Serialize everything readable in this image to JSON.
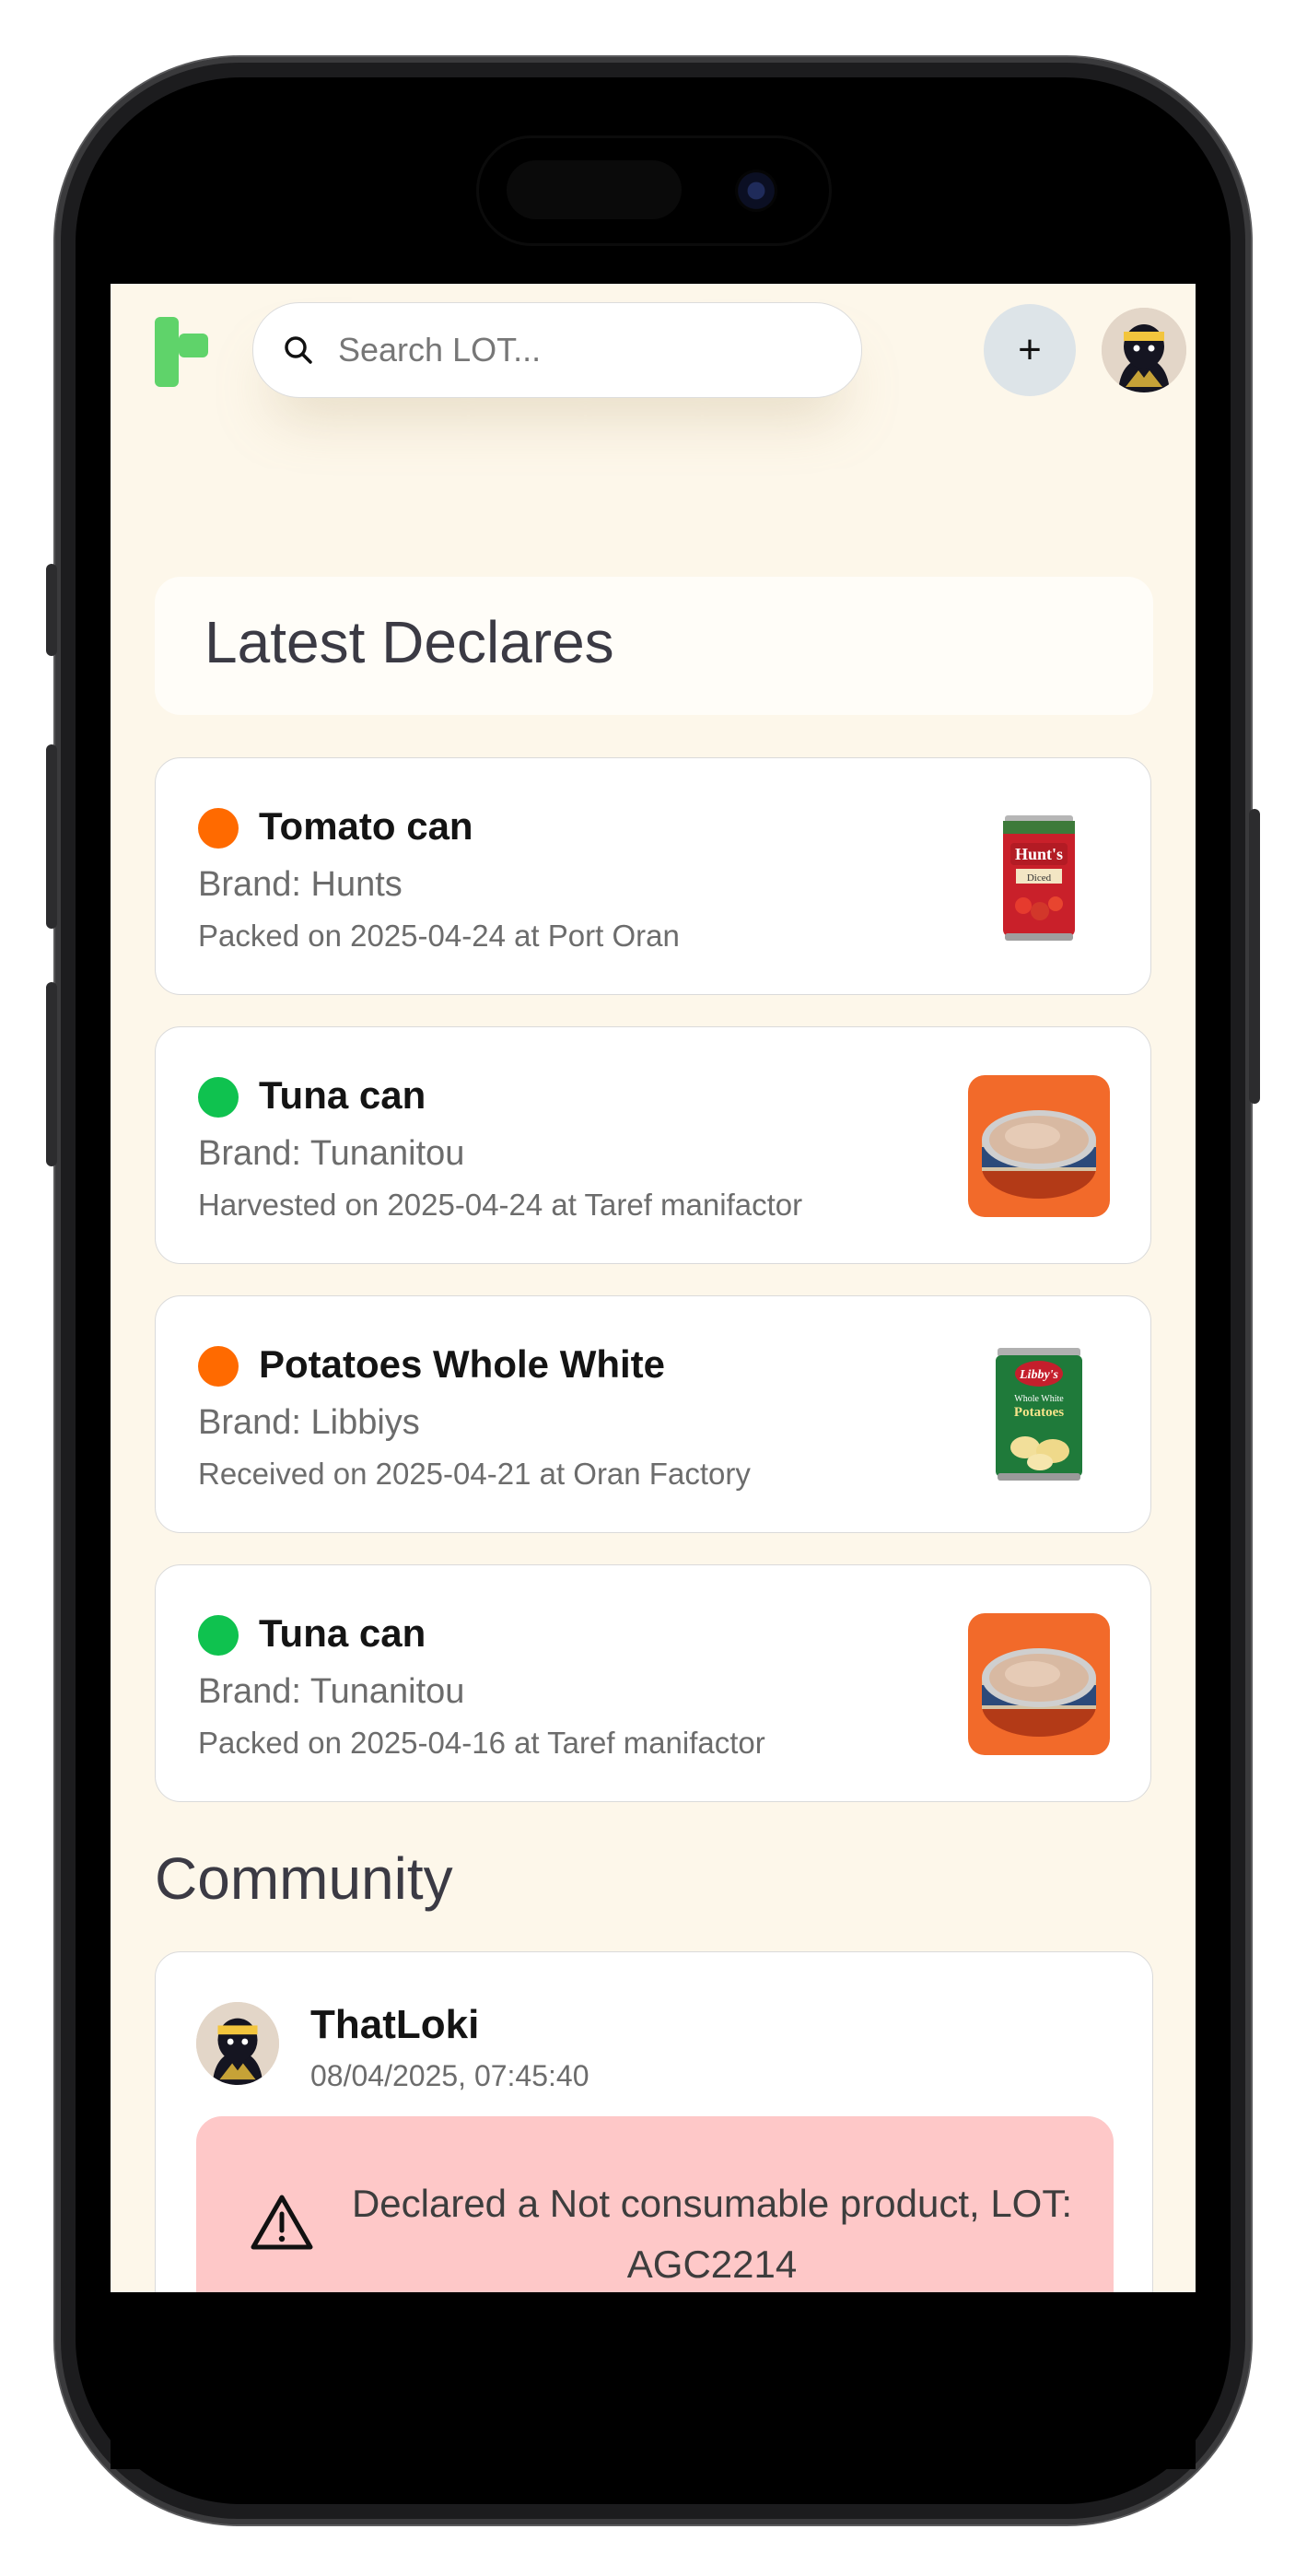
{
  "header": {
    "search": {
      "placeholder": "Search LOT..."
    },
    "add_label": "+"
  },
  "latest": {
    "title": "Latest Declares",
    "items": [
      {
        "title": "Tomato can",
        "brand": "Brand: Hunts",
        "detail": "Packed on 2025-04-24 at Port Oran",
        "status_color": "#ff6a00",
        "thumb": "hunts-diced-tomato-can"
      },
      {
        "title": "Tuna can",
        "brand": "Brand: Tunanitou",
        "detail": "Harvested on 2025-04-24 at Taref manifactor",
        "status_color": "#0fc24f",
        "thumb": "tuna-can"
      },
      {
        "title": "Potatoes Whole White",
        "brand": "Brand: Libbiys",
        "detail": "Received on 2025-04-21 at Oran Factory",
        "status_color": "#ff6a00",
        "thumb": "libbys-potatoes-can"
      },
      {
        "title": "Tuna can",
        "brand": "Brand: Tunanitou",
        "detail": "Packed on 2025-04-16 at Taref manifactor",
        "status_color": "#0fc24f",
        "thumb": "tuna-can"
      }
    ]
  },
  "community": {
    "title": "Community",
    "posts": [
      {
        "user": "ThatLoki",
        "time": "08/04/2025, 07:45:40",
        "message": "Declared a Not consumable product, LOT: AGC2214",
        "alert_icon": "warning-triangle-icon"
      }
    ]
  },
  "colors": {
    "background": "#fdf7ea",
    "brand_green": "#5fd36a",
    "alert_bg": "#fec8c8"
  }
}
